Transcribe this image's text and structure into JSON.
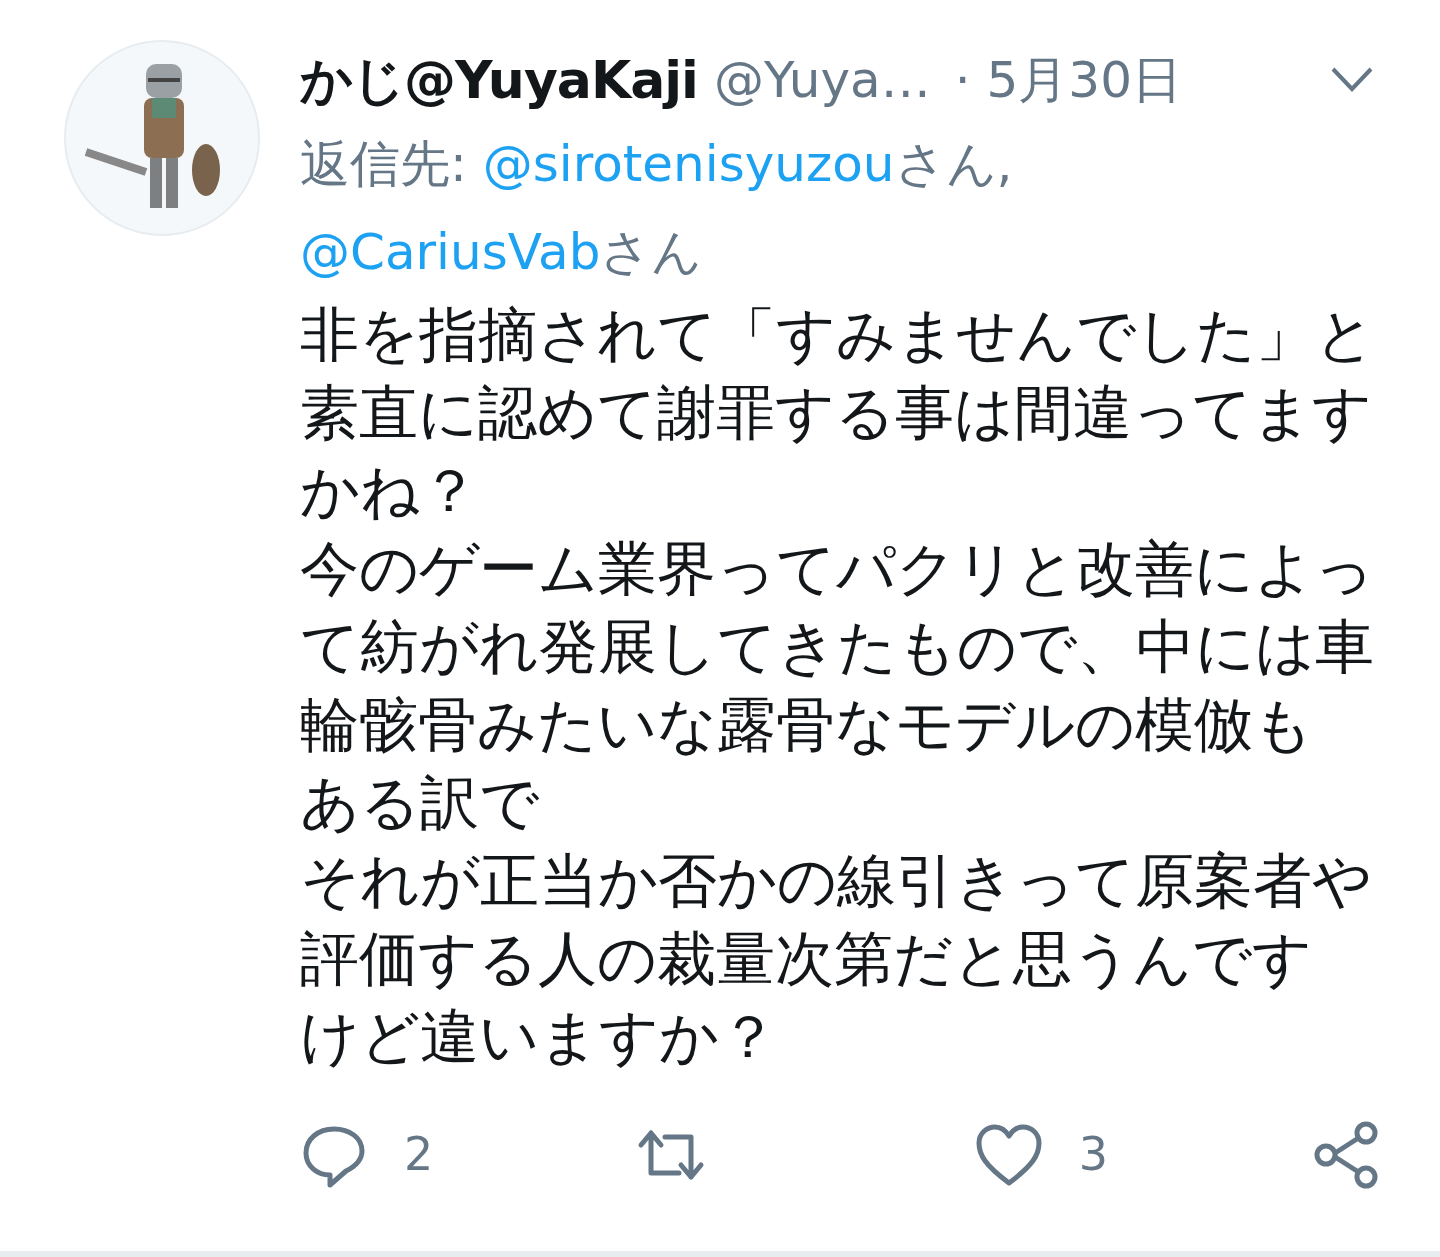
{
  "tweet": {
    "author_name": "かじ@YuyaKaji",
    "handle": "@Yuya…",
    "separator": "·",
    "date": "5月30日",
    "reply_to": {
      "label": "返信先:",
      "mentions": [
        {
          "handle": "@sirotenisyuzou",
          "suffix": "さん,"
        },
        {
          "handle": "@CariusVab",
          "suffix": "さん"
        }
      ]
    },
    "paragraphs": [
      "非を指摘されて「すみませんでした」と素直に認めて謝罪する事は間違ってますかね？",
      "今のゲーム業界ってパクリと改善によって紡がれ発展してきたもので、中には車輪骸骨みたいな露骨なモデルの模倣も",
      "ある訳で",
      "それが正当か否かの線引きって原案者や評価する人の裁量次第だと思うんです",
      "けど違いますか？"
    ],
    "actions": [
      {
        "kind": "reply",
        "count": "2"
      },
      {
        "kind": "retweet"
      },
      {
        "kind": "like",
        "count": "3"
      },
      {
        "kind": "share"
      }
    ]
  }
}
